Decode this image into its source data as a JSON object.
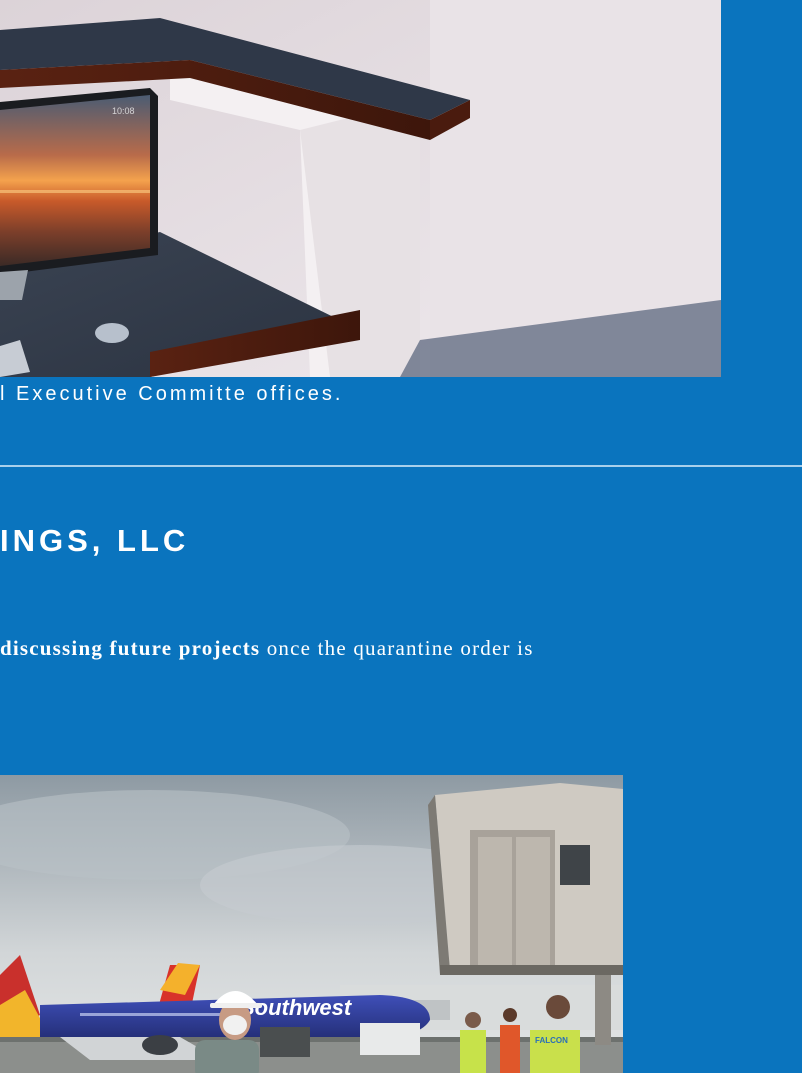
{
  "office_render": {
    "monitor_clock": "10:08"
  },
  "caption": {
    "text": "l Executive Committe offices."
  },
  "section": {
    "title": "INGS, LLC",
    "body_emphasis": "discussing future projects",
    "body_rest": " once the quarantine order is"
  },
  "photo": {
    "plane_livery": "Southwest",
    "vest_text": "FALCON"
  }
}
